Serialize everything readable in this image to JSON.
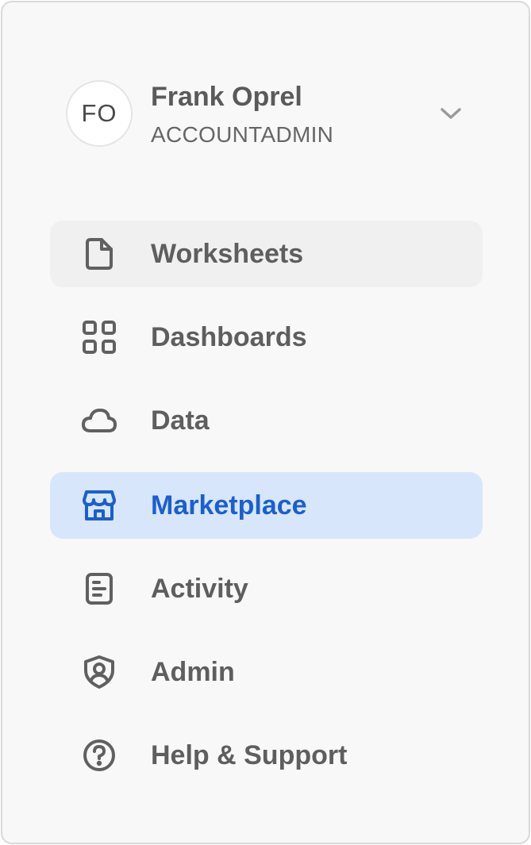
{
  "user": {
    "initials": "FO",
    "name": "Frank Oprel",
    "role": "ACCOUNTADMIN",
    "menu_icon": "chevron-down-icon"
  },
  "nav": {
    "items": [
      {
        "label": "Worksheets",
        "icon": "file-icon",
        "state": "hover"
      },
      {
        "label": "Dashboards",
        "icon": "grid-icon",
        "state": "default"
      },
      {
        "label": "Data",
        "icon": "cloud-icon",
        "state": "default"
      },
      {
        "label": "Marketplace",
        "icon": "store-icon",
        "state": "active"
      },
      {
        "label": "Activity",
        "icon": "activity-icon",
        "state": "default"
      },
      {
        "label": "Admin",
        "icon": "shield-user-icon",
        "state": "default"
      },
      {
        "label": "Help & Support",
        "icon": "help-icon",
        "state": "default"
      }
    ]
  },
  "colors": {
    "active_background": "#d8e6fb",
    "active_text": "#1a5fcf",
    "hover_background": "#f0f0f0",
    "text": "#5e5e5e",
    "panel_background": "#f8f8f8"
  }
}
